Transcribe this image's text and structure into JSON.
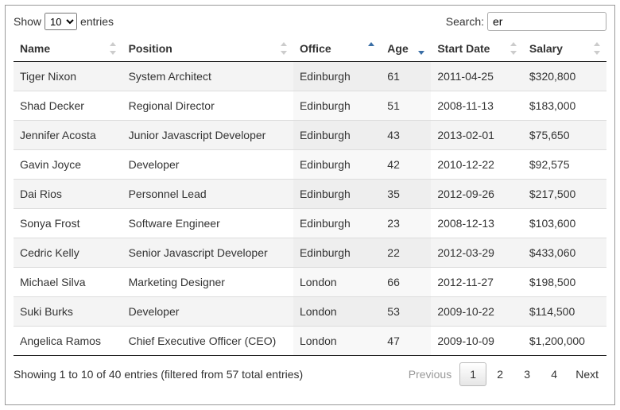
{
  "controls": {
    "show_label_pre": "Show",
    "show_label_post": "entries",
    "length_value": "10",
    "search_label": "Search:",
    "search_value": "er"
  },
  "columns": [
    {
      "key": "name",
      "label": "Name",
      "sort": "none"
    },
    {
      "key": "position",
      "label": "Position",
      "sort": "none"
    },
    {
      "key": "office",
      "label": "Office",
      "sort": "asc"
    },
    {
      "key": "age",
      "label": "Age",
      "sort": "desc"
    },
    {
      "key": "start_date",
      "label": "Start Date",
      "sort": "none"
    },
    {
      "key": "salary",
      "label": "Salary",
      "sort": "none"
    }
  ],
  "rows": [
    {
      "name": "Tiger Nixon",
      "position": "System Architect",
      "office": "Edinburgh",
      "age": "61",
      "start_date": "2011-04-25",
      "salary": "$320,800"
    },
    {
      "name": "Shad Decker",
      "position": "Regional Director",
      "office": "Edinburgh",
      "age": "51",
      "start_date": "2008-11-13",
      "salary": "$183,000"
    },
    {
      "name": "Jennifer Acosta",
      "position": "Junior Javascript Developer",
      "office": "Edinburgh",
      "age": "43",
      "start_date": "2013-02-01",
      "salary": "$75,650"
    },
    {
      "name": "Gavin Joyce",
      "position": "Developer",
      "office": "Edinburgh",
      "age": "42",
      "start_date": "2010-12-22",
      "salary": "$92,575"
    },
    {
      "name": "Dai Rios",
      "position": "Personnel Lead",
      "office": "Edinburgh",
      "age": "35",
      "start_date": "2012-09-26",
      "salary": "$217,500"
    },
    {
      "name": "Sonya Frost",
      "position": "Software Engineer",
      "office": "Edinburgh",
      "age": "23",
      "start_date": "2008-12-13",
      "salary": "$103,600"
    },
    {
      "name": "Cedric Kelly",
      "position": "Senior Javascript Developer",
      "office": "Edinburgh",
      "age": "22",
      "start_date": "2012-03-29",
      "salary": "$433,060"
    },
    {
      "name": "Michael Silva",
      "position": "Marketing Designer",
      "office": "London",
      "age": "66",
      "start_date": "2012-11-27",
      "salary": "$198,500"
    },
    {
      "name": "Suki Burks",
      "position": "Developer",
      "office": "London",
      "age": "53",
      "start_date": "2009-10-22",
      "salary": "$114,500"
    },
    {
      "name": "Angelica Ramos",
      "position": "Chief Executive Officer (CEO)",
      "office": "London",
      "age": "47",
      "start_date": "2009-10-09",
      "salary": "$1,200,000"
    }
  ],
  "info": "Showing 1 to 10 of 40 entries (filtered from 57 total entries)",
  "pagination": {
    "previous": "Previous",
    "next": "Next",
    "pages": [
      "1",
      "2",
      "3",
      "4"
    ],
    "current": "1",
    "prev_disabled": true,
    "next_disabled": false
  }
}
